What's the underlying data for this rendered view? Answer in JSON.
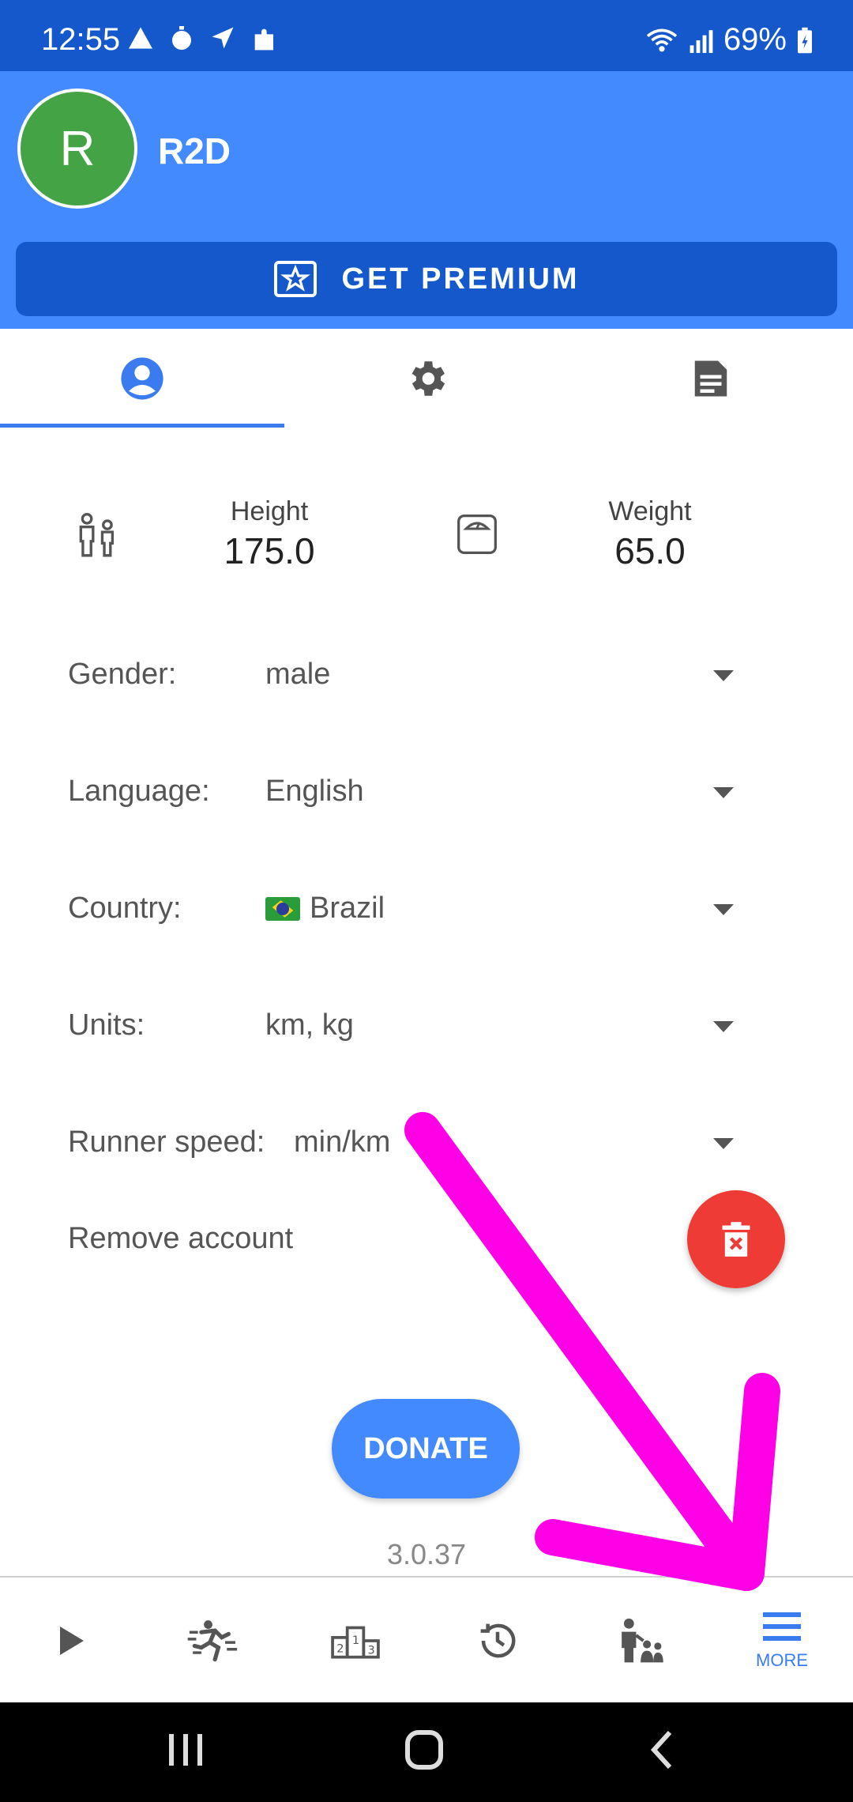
{
  "status_bar": {
    "time": "12:55",
    "battery": "69%"
  },
  "header": {
    "avatar_initial": "R",
    "username": "R2D"
  },
  "premium": {
    "label": "GET PREMIUM"
  },
  "tabs": [
    {
      "name": "profile",
      "icon": "account-circle-icon",
      "selected": true
    },
    {
      "name": "settings",
      "icon": "gear-icon",
      "selected": false
    },
    {
      "name": "document",
      "icon": "document-icon",
      "selected": false
    }
  ],
  "metrics": {
    "height_label": "Height",
    "height_value": "175.0",
    "weight_label": "Weight",
    "weight_value": "65.0"
  },
  "form": {
    "gender_label": "Gender:",
    "gender_value": "male",
    "language_label": "Language:",
    "language_value": "English",
    "country_label": "Country:",
    "country_value": "Brazil",
    "units_label": "Units:",
    "units_value": "km, kg",
    "speed_label": "Runner speed:",
    "speed_value": "min/km"
  },
  "remove_account_label": "Remove account",
  "donate_label": "DONATE",
  "version": "3.0.37",
  "bottom_nav": {
    "more_label": "MORE"
  },
  "colors": {
    "primary": "#448aff",
    "primary_dark": "#1558cc",
    "avatar": "#44a345",
    "danger": "#ef3b35",
    "annotation": "#ff00e6"
  }
}
